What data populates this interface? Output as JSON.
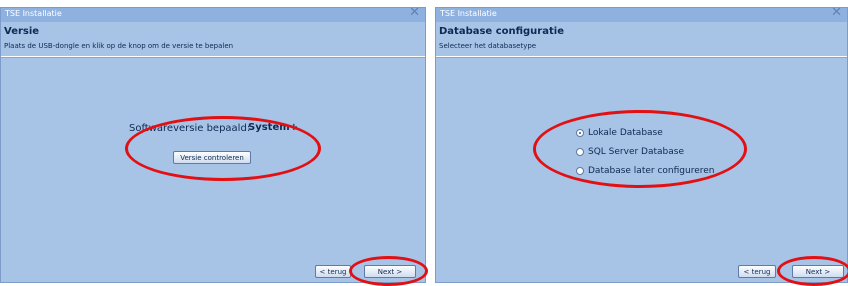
{
  "left_window": {
    "title": "TSE Installatie",
    "close_glyph": "✕",
    "heading": "Versie",
    "subtitle": "Plaats de USB-dongle en klik op de knop om de versie te bepalen",
    "version_label": "Softwareversie bepaald:",
    "version_value": "System+",
    "check_button": "Versie controleren",
    "back_button": "< terug",
    "next_button": "Next >"
  },
  "right_window": {
    "title": "TSE Installatie",
    "close_glyph": "✕",
    "heading": "Database configuratie",
    "subtitle": "Selecteer het databasetype",
    "options": [
      {
        "label": "Lokale Database",
        "selected": true
      },
      {
        "label": "SQL Server Database",
        "selected": false
      },
      {
        "label": "Database later configureren",
        "selected": false
      }
    ],
    "back_button": "< terug",
    "next_button": "Next >"
  },
  "annotation_color": "#e21012"
}
